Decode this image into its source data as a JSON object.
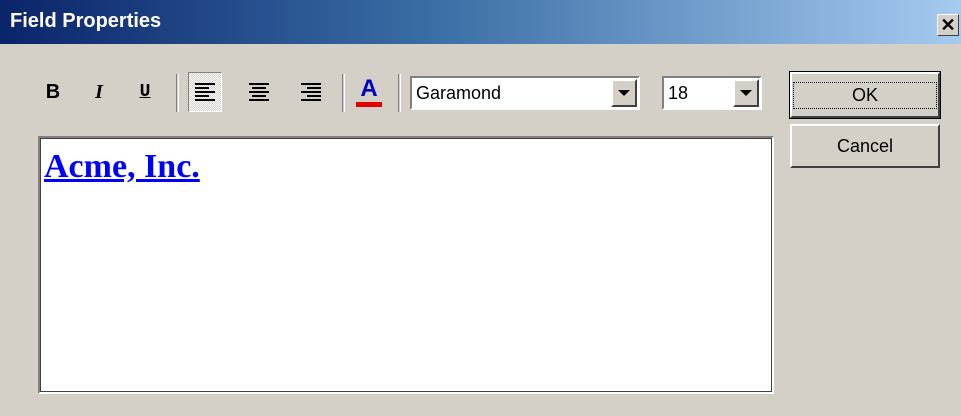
{
  "window": {
    "title": "Field Properties",
    "close_label": "✕"
  },
  "toolbar": {
    "bold_label": "B",
    "italic_label": "I",
    "underline_label": "U",
    "align_left": "align-left-icon",
    "align_center": "align-center-icon",
    "align_right": "align-right-icon",
    "color_label": "A",
    "font_color": "#e00000",
    "font_name": "Garamond",
    "font_size": "18"
  },
  "buttons": {
    "ok_label": "OK",
    "cancel_label": "Cancel"
  },
  "editor": {
    "content": "Acme, Inc.",
    "text_color": "#0000ff"
  }
}
